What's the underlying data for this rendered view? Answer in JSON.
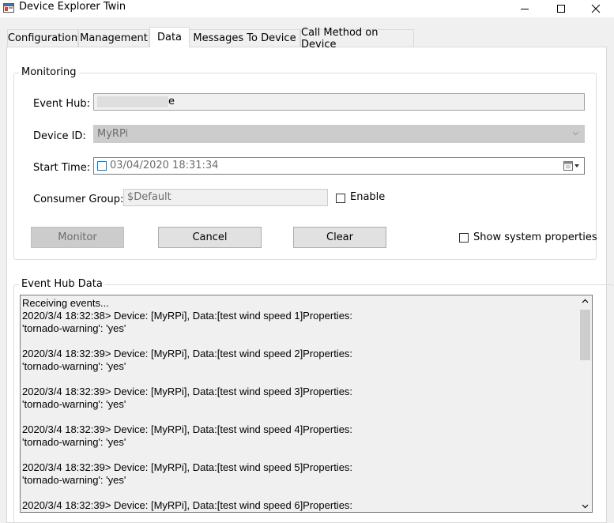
{
  "window": {
    "title": "Device Explorer Twin",
    "app_icon": "app-window-icon",
    "controls": [
      "minimize-icon",
      "maximize-icon",
      "close-icon"
    ]
  },
  "tabs": [
    {
      "label": "Configuration",
      "active": false
    },
    {
      "label": "Management",
      "active": false
    },
    {
      "label": "Data",
      "active": true
    },
    {
      "label": "Messages To Device",
      "active": false
    },
    {
      "label": "Call Method on Device",
      "active": false
    }
  ],
  "monitoring": {
    "group_label": "Monitoring",
    "event_hub_label": "Event Hub:",
    "event_hub_value": "e",
    "device_id_label": "Device ID:",
    "device_id_value": "MyRPi",
    "start_time_label": "Start Time:",
    "start_time_value": "03/04/2020 18:31:34",
    "start_time_checked": false,
    "consumer_group_label": "Consumer Group:",
    "consumer_group_value": "$Default",
    "enable_label": "Enable",
    "enable_checked": false,
    "monitor_button": "Monitor",
    "cancel_button": "Cancel",
    "clear_button": "Clear",
    "show_system_properties_label": "Show system properties",
    "show_system_properties_checked": false
  },
  "event_hub_data": {
    "group_label": "Event Hub Data",
    "lines": [
      "Receiving events...",
      "2020/3/4 18:32:38> Device: [MyRPi], Data:[test wind speed 1]Properties:",
      "'tornado-warning': 'yes'",
      "",
      "2020/3/4 18:32:39> Device: [MyRPi], Data:[test wind speed 2]Properties:",
      "'tornado-warning': 'yes'",
      "",
      "2020/3/4 18:32:39> Device: [MyRPi], Data:[test wind speed 3]Properties:",
      "'tornado-warning': 'yes'",
      "",
      "2020/3/4 18:32:39> Device: [MyRPi], Data:[test wind speed 4]Properties:",
      "'tornado-warning': 'yes'",
      "",
      "2020/3/4 18:32:39> Device: [MyRPi], Data:[test wind speed 5]Properties:",
      "'tornado-warning': 'yes'",
      "",
      "2020/3/4 18:32:39> Device: [MyRPi], Data:[test wind speed 6]Properties:"
    ]
  },
  "colors": {
    "accent": "#0078d7",
    "window_bg": "#f0f0f0",
    "panel_bg": "#ffffff",
    "disabled_bg": "#cccccc"
  }
}
